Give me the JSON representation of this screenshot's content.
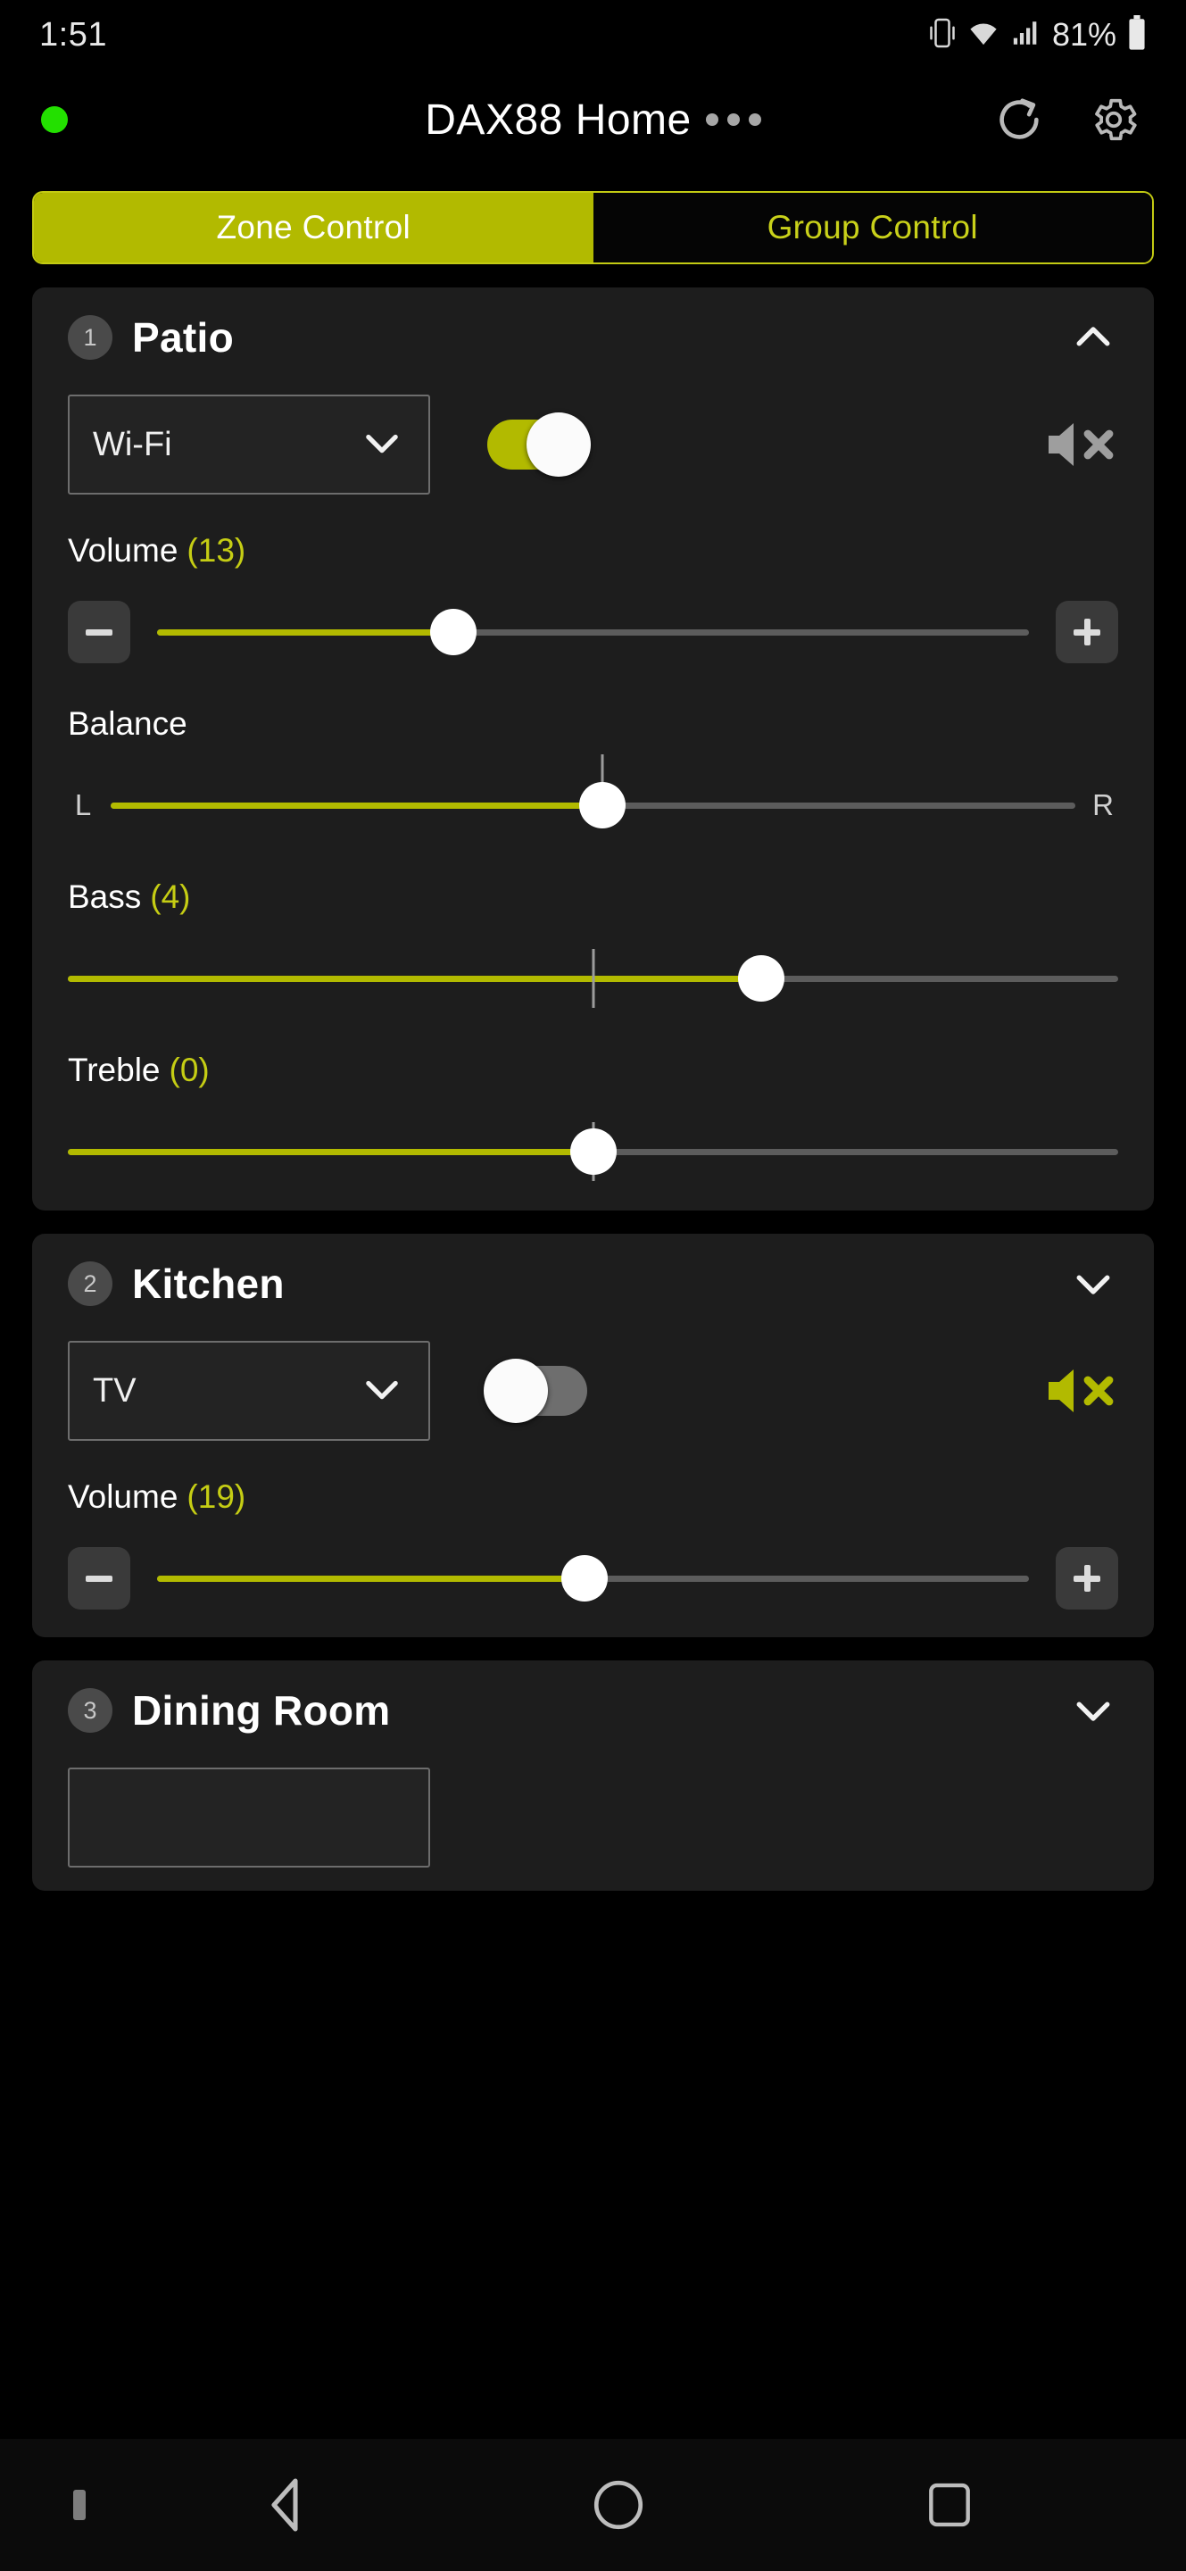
{
  "status_bar": {
    "time": "1:51",
    "battery_percent": "81%",
    "icons": [
      "vibrate-icon",
      "wifi-icon",
      "cellular-signal-icon",
      "battery-icon"
    ]
  },
  "header": {
    "title": "DAX88 Home",
    "connection_dot_color": "#23e000",
    "overflow_icon": "three-dots-icon",
    "refresh_icon": "refresh-icon",
    "settings_icon": "gear-icon"
  },
  "tabs": {
    "active_index": 0,
    "items": [
      {
        "label": "Zone Control",
        "active": true
      },
      {
        "label": "Group Control",
        "active": false
      }
    ],
    "active_bg": "#b2ba00",
    "inactive_text": "#c9d11a"
  },
  "accent": "#b2ba00",
  "accent_text": "#c5cd14",
  "zones": [
    {
      "number": "1",
      "name": "Patio",
      "expanded": true,
      "chevron": "chevron-up-icon",
      "source": {
        "value": "Wi-Fi",
        "chevron": "chevron-down-icon"
      },
      "power": {
        "on": true
      },
      "mute": {
        "muted": false,
        "icon": "speaker-mute-icon",
        "color": "#9e9e9e"
      },
      "volume": {
        "label": "Volume",
        "value": "(13)",
        "percent": 34,
        "minus_label": "minus-button",
        "plus_label": "plus-button"
      },
      "balance": {
        "label": "Balance",
        "left_label": "L",
        "right_label": "R",
        "percent": 51,
        "center_percent": 51
      },
      "bass": {
        "label": "Bass",
        "value": "(4)",
        "percent": 66,
        "center_percent": 50
      },
      "treble": {
        "label": "Treble",
        "value": "(0)",
        "percent": 50,
        "center_percent": 50
      }
    },
    {
      "number": "2",
      "name": "Kitchen",
      "expanded": false,
      "chevron": "chevron-down-icon",
      "source": {
        "value": "TV",
        "chevron": "chevron-down-icon"
      },
      "power": {
        "on": false
      },
      "mute": {
        "muted": true,
        "icon": "speaker-mute-icon",
        "color": "#b2ba00"
      },
      "volume": {
        "label": "Volume",
        "value": "(19)",
        "percent": 49,
        "minus_label": "minus-button",
        "plus_label": "plus-button"
      }
    },
    {
      "number": "3",
      "name": "Dining Room",
      "expanded": false,
      "chevron": "chevron-down-icon"
    }
  ],
  "nav_bar": {
    "back_icon": "back-triangle-icon",
    "home_icon": "home-circle-icon",
    "recents_icon": "recents-square-icon"
  }
}
